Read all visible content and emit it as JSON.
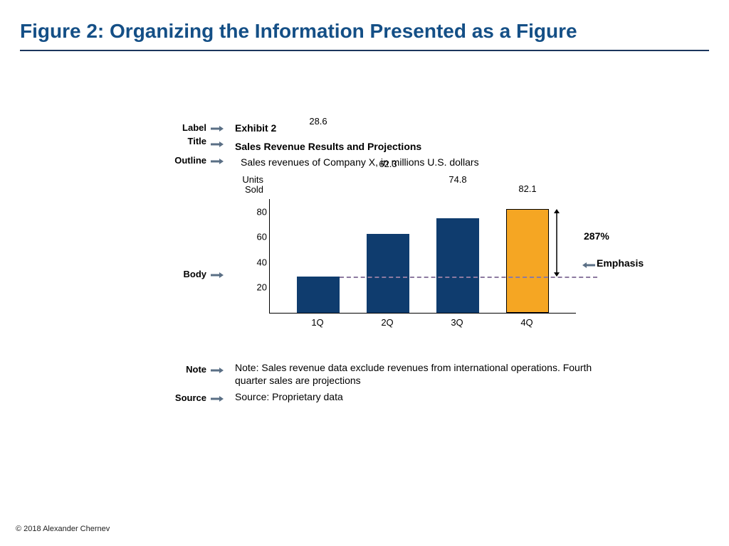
{
  "page": {
    "title": "Figure 2: Organizing the Information Presented as a Figure",
    "copyright": "© 2018 Alexander Chernev"
  },
  "annotations": {
    "label": "Label",
    "title": "Title",
    "outline": "Outline",
    "body": "Body",
    "note": "Note",
    "source": "Source"
  },
  "exhibit": {
    "label": "Exhibit 2",
    "title": "Sales Revenue Results and Projections",
    "outline": "Sales revenues of Company X, in millions U.S. dollars",
    "note": "Note: Sales revenue data exclude revenues from international operations. Fourth quarter sales are projections",
    "source": "Source: Proprietary data"
  },
  "chart_data": {
    "type": "bar",
    "ylabel": "Units Sold",
    "xlabel": "",
    "categories": [
      "1Q",
      "2Q",
      "3Q",
      "4Q"
    ],
    "values": [
      28.6,
      62.3,
      74.8,
      82.1
    ],
    "emphasis_index": 3,
    "y_ticks": [
      20,
      40,
      60,
      80
    ],
    "ylim": [
      0,
      90
    ],
    "pct_change_label": "287%",
    "emphasis_label": "Emphasis",
    "title": "",
    "colors": {
      "bar": "#0f3c6e",
      "emphasis": "#f5a623"
    }
  }
}
